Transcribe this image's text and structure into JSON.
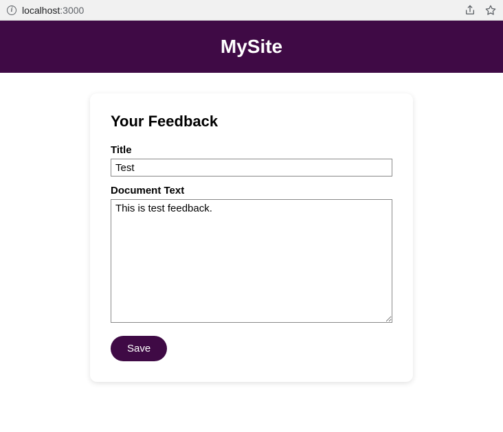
{
  "browser": {
    "url_host": "localhost",
    "url_port": ":3000"
  },
  "header": {
    "site_title": "MySite"
  },
  "card": {
    "heading": "Your Feedback"
  },
  "form": {
    "title_label": "Title",
    "title_value": "Test",
    "body_label": "Document Text",
    "body_value": "This is test feedback.",
    "save_label": "Save"
  },
  "colors": {
    "brand": "#3f0a45"
  }
}
